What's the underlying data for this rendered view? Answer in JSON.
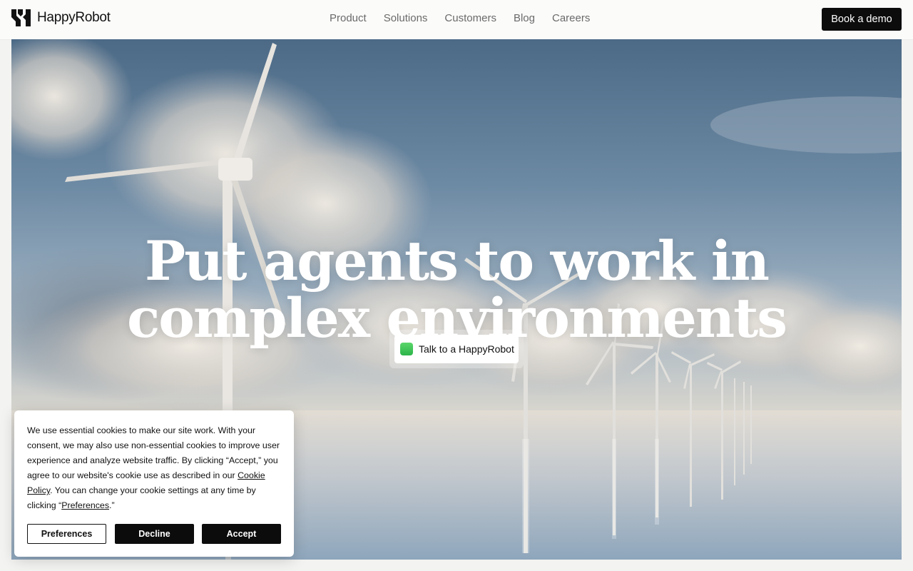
{
  "brand": {
    "name": "HappyRobot"
  },
  "nav": {
    "links": [
      "Product",
      "Solutions",
      "Customers",
      "Blog",
      "Careers"
    ],
    "cta": "Book a demo"
  },
  "hero": {
    "headline_line1": "Put agents to work in",
    "headline_line2": "complex environments",
    "talk_button": "Talk to a HappyRobot",
    "talk_icon": "phone-icon"
  },
  "cookie": {
    "text_intro": "We use essential cookies to make our site work. With your consent, we may also use non-essential cookies to improve user experience and analyze website traffic. By clicking “Accept,” you agree to our website's cookie use as described in our ",
    "policy_link": "Cookie Policy",
    "text_mid": ". You can change your cookie settings at any time by clicking “",
    "preferences_link": "Preferences",
    "text_end": ".”",
    "buttons": {
      "preferences": "Preferences",
      "decline": "Decline",
      "accept": "Accept"
    }
  }
}
